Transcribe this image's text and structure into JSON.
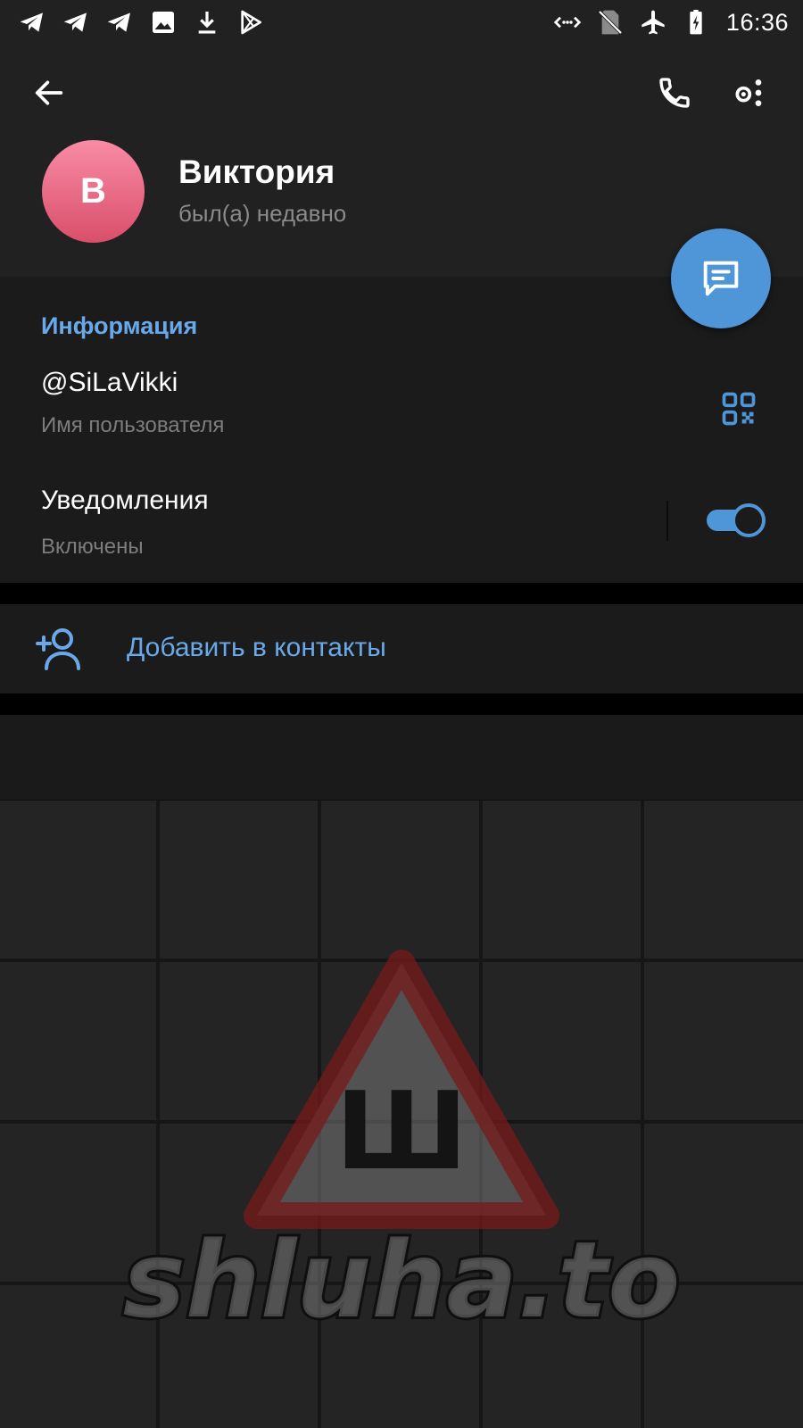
{
  "status_bar": {
    "left_icons": [
      "telegram-icon",
      "telegram-icon",
      "telegram-icon",
      "image-icon",
      "download-icon",
      "play-store-icon"
    ],
    "right_icons": [
      "data-saver-icon",
      "no-sim-icon",
      "airplane-icon",
      "battery-charging-icon"
    ],
    "time": "16:36"
  },
  "header": {
    "avatar_letter": "В",
    "name": "Виктория",
    "status": "был(а) недавно"
  },
  "info": {
    "section_title": "Информация",
    "username": "@SiLaVikki",
    "username_label": "Имя пользователя",
    "notifications_title": "Уведомления",
    "notifications_value": "Включены",
    "notifications_on": true
  },
  "actions": {
    "add_contact": "Добавить в контакты"
  },
  "watermark": {
    "text": "shluha.to",
    "sign_letter": "Ш"
  },
  "colors": {
    "accent": "#4f96d8",
    "accent_text": "#6aa9e9",
    "background": "#1b1b1b",
    "header_bg": "#212121",
    "avatar_gradient_top": "#f98ba5",
    "avatar_gradient_bottom": "#d94f6b"
  }
}
